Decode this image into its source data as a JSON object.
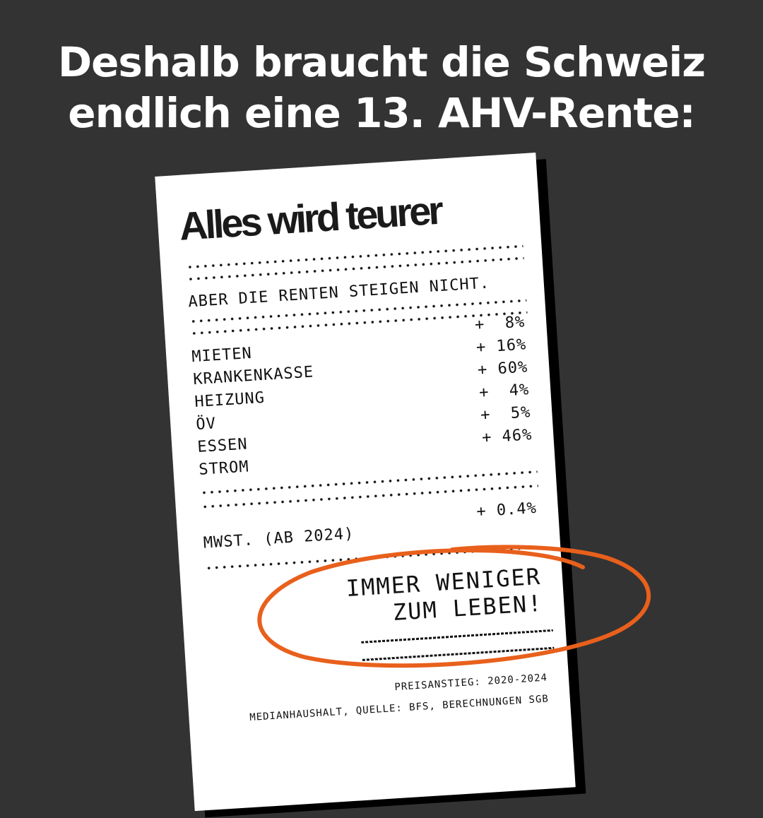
{
  "headline": {
    "line1": "Deshalb braucht die Schweiz",
    "line2": "endlich eine 13. AHV-Rente:"
  },
  "receipt": {
    "title": "Alles wird teurer",
    "subtitle": "ABER DIE RENTEN STEIGEN NICHT.",
    "items": [
      {
        "name": "MIETEN",
        "value": "+  8%"
      },
      {
        "name": "KRANKENKASSE",
        "value": "+ 16%"
      },
      {
        "name": "HEIZUNG",
        "value": "+ 60%"
      },
      {
        "name": "ÖV",
        "value": "+  4%"
      },
      {
        "name": "ESSEN",
        "value": "+  5%"
      },
      {
        "name": "STROM",
        "value": "+ 46%"
      }
    ],
    "vat": {
      "name": "MWST. (AB 2024)",
      "value": "+ 0.4%"
    },
    "message": {
      "line1": "IMMER WENIGER",
      "line2": "ZUM LEBEN!"
    },
    "footer": {
      "line1": "PREISANSTIEG: 2020-2024",
      "line2": "MEDIANHAUSHALT, QUELLE: BFS, BERECHNUNGEN SGB"
    }
  },
  "colors": {
    "background": "#333333",
    "accent": "#e8601c",
    "paper": "#ffffff"
  }
}
